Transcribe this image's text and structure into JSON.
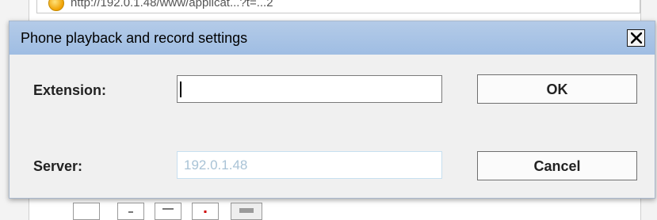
{
  "background": {
    "url_text": "http://192.0.1.48/www/applicat...?t=...2"
  },
  "dialog": {
    "title": "Phone playback and record settings",
    "close_glyph": "X",
    "extension": {
      "label": "Extension:",
      "value": "",
      "placeholder": ""
    },
    "server": {
      "label": "Server:",
      "value": "",
      "placeholder": "192.0.1.48"
    },
    "ok_label": "OK",
    "cancel_label": "Cancel"
  },
  "colors": {
    "titlebar": "#a8c4e8",
    "dialog_bg": "#f0f0f0",
    "placeholder": "#a9c3d6"
  },
  "icons": {
    "close": "close-icon",
    "browser_favicon": "browser-favicon-icon"
  }
}
